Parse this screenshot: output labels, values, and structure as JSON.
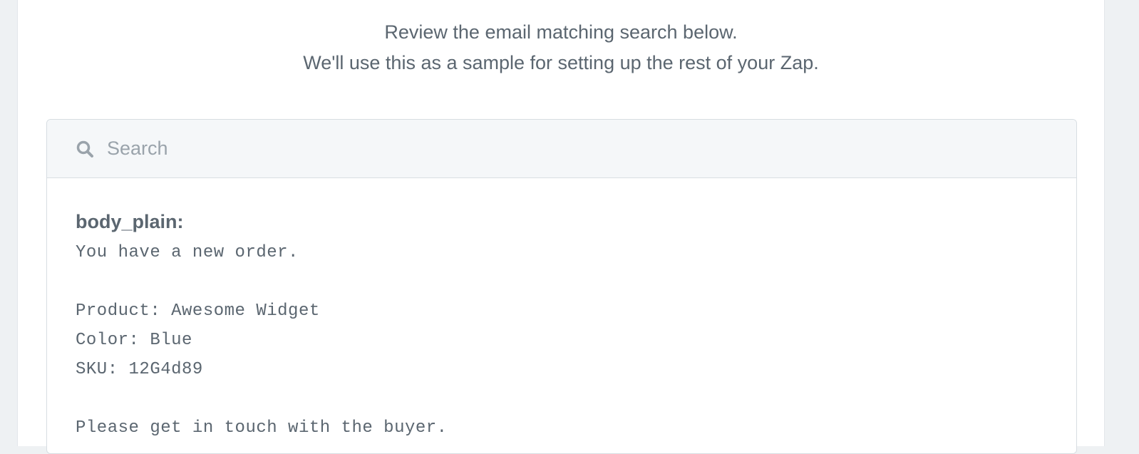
{
  "intro": {
    "line1": "Review the email matching search below.",
    "line2": "We'll use this as a sample for setting up the rest of your Zap."
  },
  "search": {
    "placeholder": "Search",
    "value": "",
    "icon": "search-icon"
  },
  "record": {
    "field_label": "body_plain:",
    "field_value": "You have a new order.\n\nProduct: Awesome Widget\nColor: Blue\nSKU: 12G4d89\n\nPlease get in touch with the buyer."
  },
  "colors": {
    "text": "#5b6670",
    "placeholder": "#9aa3ab",
    "search_bg": "#f5f7f9",
    "page_bg": "#eef1f3",
    "border": "#d7dde2"
  }
}
